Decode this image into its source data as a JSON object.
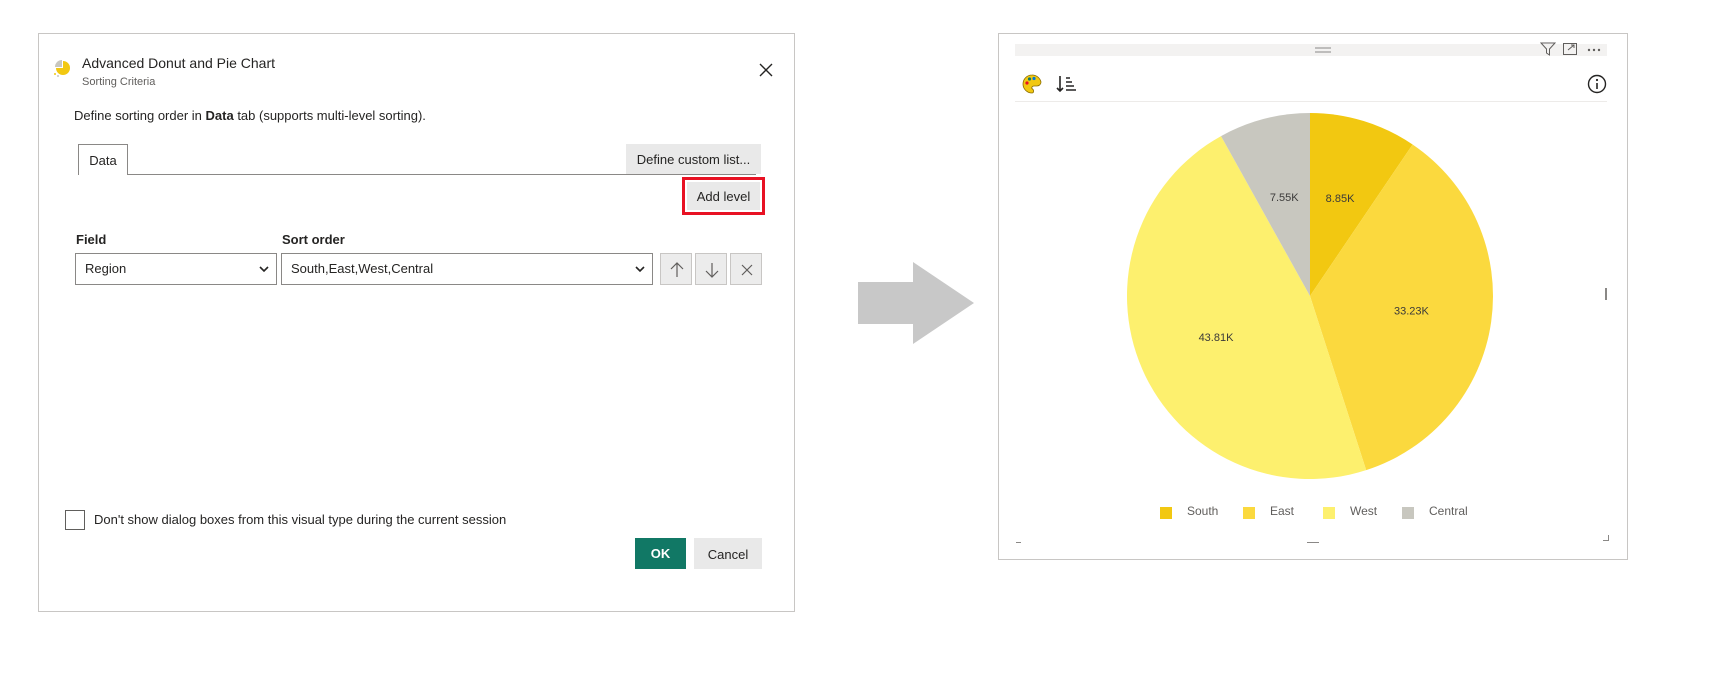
{
  "dialog": {
    "title": "Advanced Donut and Pie Chart",
    "subtitle": "Sorting Criteria",
    "description_pre": "Define sorting order in ",
    "description_bold": "Data",
    "description_post": " tab (supports multi-level sorting).",
    "tab_label": "Data",
    "define_custom_list_label": "Define custom list...",
    "add_level_label": "Add level",
    "field_header": "Field",
    "sort_order_header": "Sort order",
    "field_value": "Region",
    "sort_order_value": "South,East,West,Central",
    "checkbox_label": "Don't show dialog boxes from this visual type during the current session",
    "checkbox_checked": false,
    "ok_label": "OK",
    "cancel_label": "Cancel",
    "icons": [
      "yellow-pie-logo-icon",
      "close-icon",
      "arrow-up-icon",
      "arrow-down-icon",
      "delete-icon",
      "chevron-down-icon"
    ],
    "colors": {
      "ok_button": "#117865",
      "highlight": "#e81123"
    }
  },
  "visual": {
    "header_icons": [
      "filter-icon",
      "focus-mode-icon",
      "more-options-icon"
    ],
    "toolbar_icons": [
      "palette-icon",
      "sort-icon",
      "info-icon"
    ]
  },
  "chart_data": {
    "type": "pie",
    "categories": [
      "South",
      "East",
      "West",
      "Central"
    ],
    "values": [
      8.85,
      33.23,
      43.81,
      7.55
    ],
    "unit": "K",
    "data_labels": [
      "8.85K",
      "33.23K",
      "43.81K",
      "7.55K"
    ],
    "colors": [
      "#f2c811",
      "#fbd93e",
      "#fdf06e",
      "#c8c7bf"
    ],
    "legend": [
      "South",
      "East",
      "West",
      "Central"
    ],
    "legend_position": "bottom-center",
    "start_angle": "12 o'clock",
    "direction": "clockwise"
  }
}
